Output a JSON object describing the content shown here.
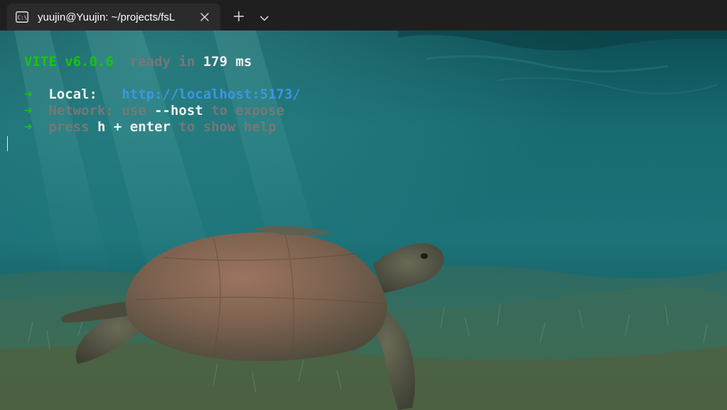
{
  "tab": {
    "title": "yuujin@Yuujin: ~/projects/fsL",
    "icon": "terminal-icon"
  },
  "toolbar": {
    "new_tab_icon": "plus-icon",
    "dropdown_icon": "chevron-down-icon"
  },
  "terminal": {
    "line1": {
      "name": "VITE",
      "version": "v6.0.6",
      "ready_text": "ready in",
      "time_value": "179",
      "time_unit": "ms"
    },
    "line2": {
      "arrow": "➜",
      "label": "Local:",
      "url": "http://localhost:5173/"
    },
    "line3": {
      "arrow": "➜",
      "label": "Network:",
      "use_text": "use",
      "flag": "--host",
      "rest": "to expose"
    },
    "line4": {
      "arrow": "➜",
      "press_text": "press",
      "keys": "h + enter",
      "rest": "to show help"
    }
  },
  "colors": {
    "green": "#16c60c",
    "blue": "#3b96e6",
    "dim": "#777777",
    "white": "#f2f2f2",
    "tab_bg": "#2b2b2b",
    "tabbar_bg": "#1f1f1f"
  }
}
